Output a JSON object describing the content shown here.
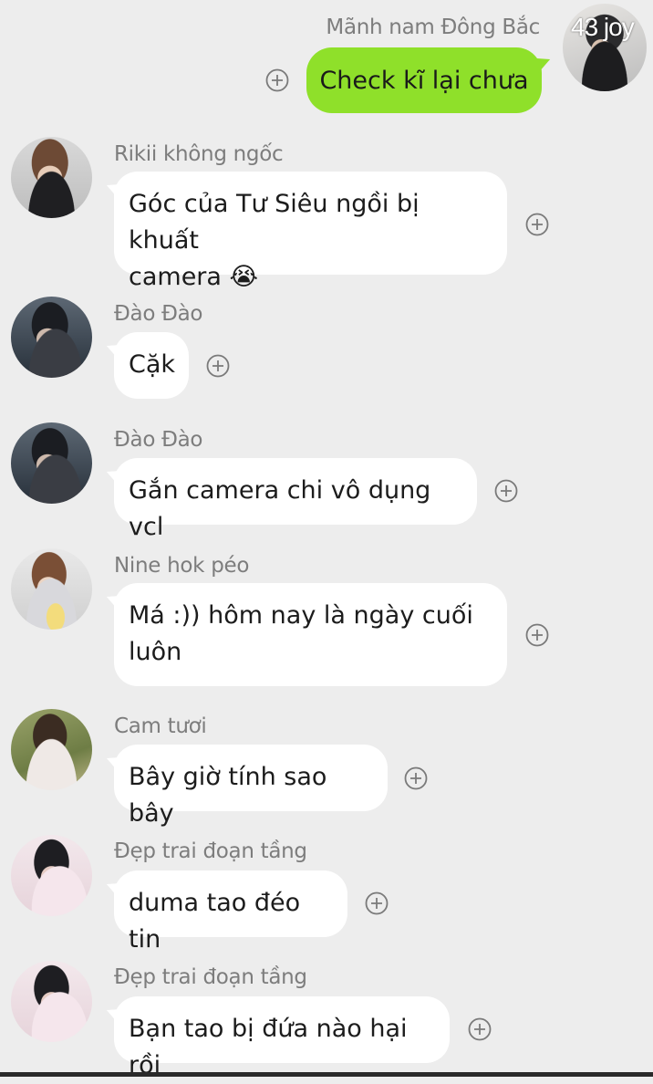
{
  "outgoing": {
    "sender": "Mãnh nam Đông Bắc",
    "text": "Check kĩ lại chưa",
    "avatar_badge": "43 joy",
    "bubble_color": "#8fe02a"
  },
  "messages": [
    {
      "sender": "Rikii không ngốc",
      "lines": [
        "Góc của Tư Siêu ngồi bị khuất",
        "camera 😭"
      ]
    },
    {
      "sender": "Đào Đào",
      "lines": [
        "Cặk"
      ]
    },
    {
      "sender": "Đào Đào",
      "lines": [
        "Gắn camera chi vô dụng vcl"
      ]
    },
    {
      "sender": "Nine hok péo",
      "lines": [
        "Má :)) hôm nay là ngày cuối",
        "luôn"
      ]
    },
    {
      "sender": "Cam tươi",
      "lines": [
        "Bây giờ tính sao bây"
      ]
    },
    {
      "sender": "Đẹp trai đoạn tầng",
      "lines": [
        "duma tao đéo tin"
      ]
    },
    {
      "sender": "Đẹp trai đoạn tầng",
      "lines": [
        "Bạn tao bị đứa nào hại rồi"
      ]
    }
  ],
  "icons": {
    "react": "plus-circle-icon"
  },
  "colors": {
    "background": "#ededed",
    "incoming_bubble": "#ffffff",
    "name_text": "#7d7d7d"
  }
}
